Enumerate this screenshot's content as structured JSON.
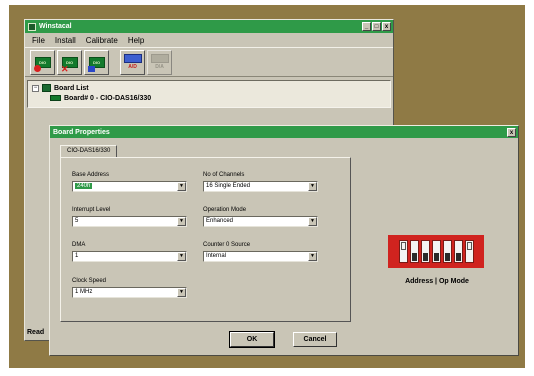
{
  "main_window": {
    "title": "Winstacal",
    "window_buttons": [
      "_",
      "□",
      "x"
    ],
    "menu": [
      "File",
      "Install",
      "Calibrate",
      "Help"
    ],
    "toolbar": {
      "chip_label": "DIO",
      "ad_label": "A/D",
      "da_label": "D/A"
    },
    "tree": {
      "root_toggle": "−",
      "root_label": "Board List",
      "child_label": "Board# 0 - CIO-DAS16/330"
    },
    "status_text": "Read"
  },
  "dialog": {
    "title": "Board Properties",
    "close_button": "x",
    "tab_label": "CIO-DAS16/330",
    "fields": {
      "base_address": {
        "label": "Base Address",
        "value": "240h"
      },
      "interrupt_level": {
        "label": "Interrupt Level",
        "value": "5"
      },
      "dma": {
        "label": "DMA",
        "value": "1"
      },
      "clock_speed": {
        "label": "Clock Speed",
        "value": "1 MHz"
      },
      "num_channels": {
        "label": "No of Channels",
        "value": "16 Single Ended"
      },
      "operation_mode": {
        "label": "Operation Mode",
        "value": "Enhanced"
      },
      "counter_source": {
        "label": "Counter 0 Source",
        "value": "Internal"
      }
    },
    "dropdown_arrow": "▼",
    "ok_label": "OK",
    "cancel_label": "Cancel",
    "dip_caption": "Address | Op Mode",
    "dip_switches": [
      "up",
      "down",
      "down",
      "down",
      "down",
      "down",
      "up"
    ]
  },
  "colors": {
    "frame": "#8f7a45",
    "window": "#c9c5b6",
    "titlebar": "#2f9a48",
    "dip_body": "#d0231f"
  }
}
